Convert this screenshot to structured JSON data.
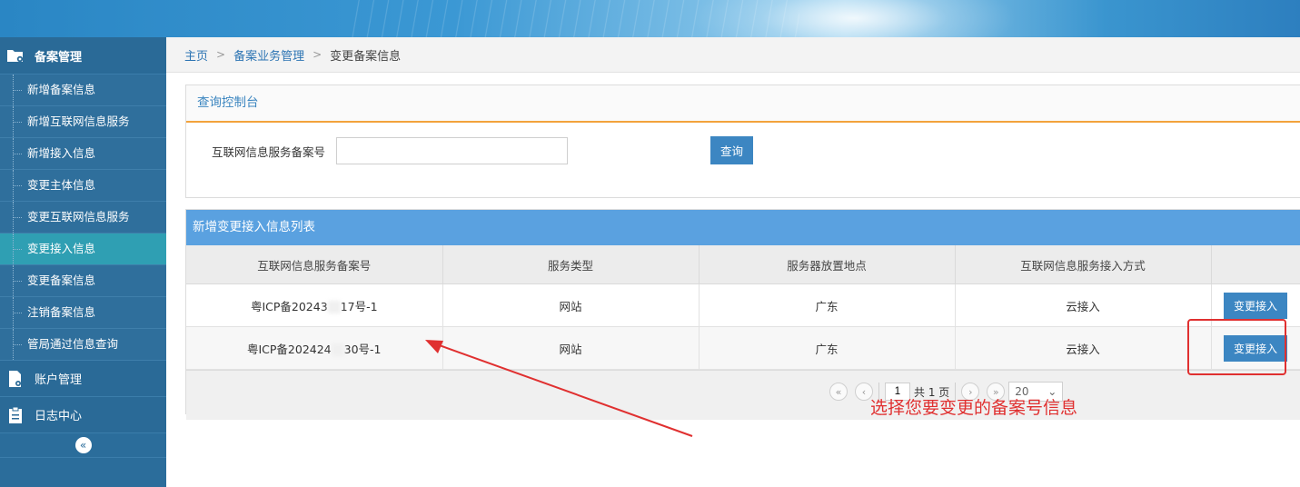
{
  "sidebar": {
    "section_title": "备案管理",
    "items": [
      {
        "label": "新增备案信息"
      },
      {
        "label": "新增互联网信息服务"
      },
      {
        "label": "新增接入信息"
      },
      {
        "label": "变更主体信息"
      },
      {
        "label": "变更互联网信息服务"
      },
      {
        "label": "变更接入信息",
        "active": true
      },
      {
        "label": "变更备案信息"
      },
      {
        "label": "注销备案信息"
      },
      {
        "label": "管局通过信息查询"
      }
    ],
    "groups": [
      {
        "label": "账户管理",
        "icon": "account-doc-gear-icon"
      },
      {
        "label": "日志中心",
        "icon": "clipboard-icon"
      }
    ],
    "collapse_icon": "double-chevron-left-icon"
  },
  "breadcrumb": {
    "home": "主页",
    "section": "备案业务管理",
    "current": "变更备案信息"
  },
  "query_panel": {
    "title": "查询控制台",
    "field_label": "互联网信息服务备案号",
    "field_value": "",
    "field_placeholder": "",
    "search_button": "查询"
  },
  "list_panel": {
    "title": "新增变更接入信息列表",
    "columns": [
      "互联网信息服务备案号",
      "服务类型",
      "服务器放置地点",
      "互联网信息服务接入方式",
      ""
    ],
    "rows": [
      {
        "record_prefix": "粤ICP备20243",
        "record_suffix": "17号-1",
        "service_type": "网站",
        "location": "广东",
        "access_method": "云接入",
        "action": "变更接入"
      },
      {
        "record_prefix": "粤ICP备202424",
        "record_suffix": "30号-1",
        "service_type": "网站",
        "location": "广东",
        "access_method": "云接入",
        "action": "变更接入"
      }
    ]
  },
  "pagination": {
    "current_page": "1",
    "total_text": "共 1 页",
    "page_size": "20"
  },
  "annotation": {
    "text": "选择您要变更的备案号信息",
    "color": "#e03030"
  },
  "colors": {
    "sidebar_bg": "#2b6d9b",
    "sidebar_active": "#2f9fb3",
    "accent_blue": "#3c86c2",
    "list_header": "#5aa1e0",
    "query_underline": "#f3a33c"
  }
}
